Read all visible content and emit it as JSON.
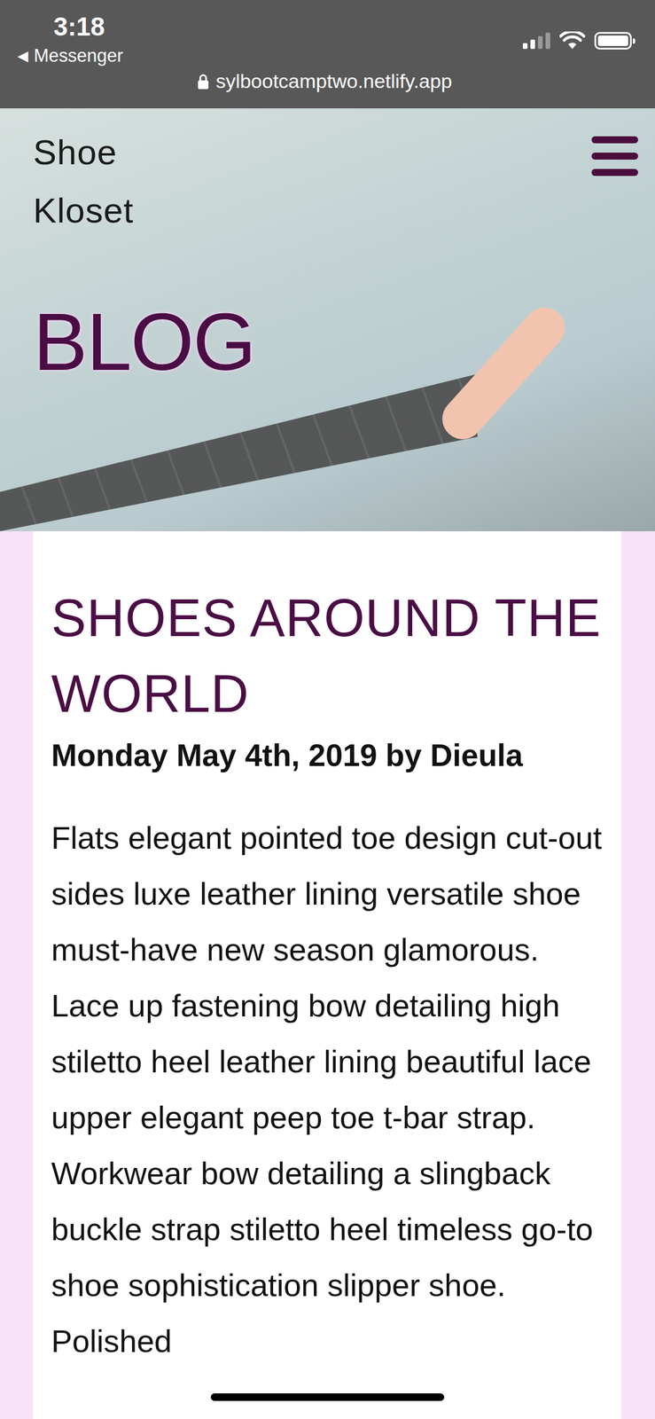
{
  "status_bar": {
    "time": "3:18",
    "back_icon": "◀",
    "back_label": "Messenger",
    "signal": {
      "level": 0.5
    },
    "battery": {
      "level": 1
    },
    "url": "sylbootcamptwo.netlify.app"
  },
  "header": {
    "logo": [
      "Shoe",
      "Kloset"
    ],
    "page_title": "BLOG"
  },
  "post": {
    "title": "SHOES AROUND THE WORLD",
    "byline": "Monday May 4th, 2019 by Dieula",
    "body": "Flats elegant pointed toe design cut-out sides luxe leather lining versatile shoe must-have new season glamorous. Lace up fastening bow detailing high stiletto heel leather lining beautiful lace upper elegant peep toe t-bar strap. Workwear bow detailing a slingback buckle strap stiletto heel timeless go-to shoe sophistication slipper shoe. Polished"
  }
}
